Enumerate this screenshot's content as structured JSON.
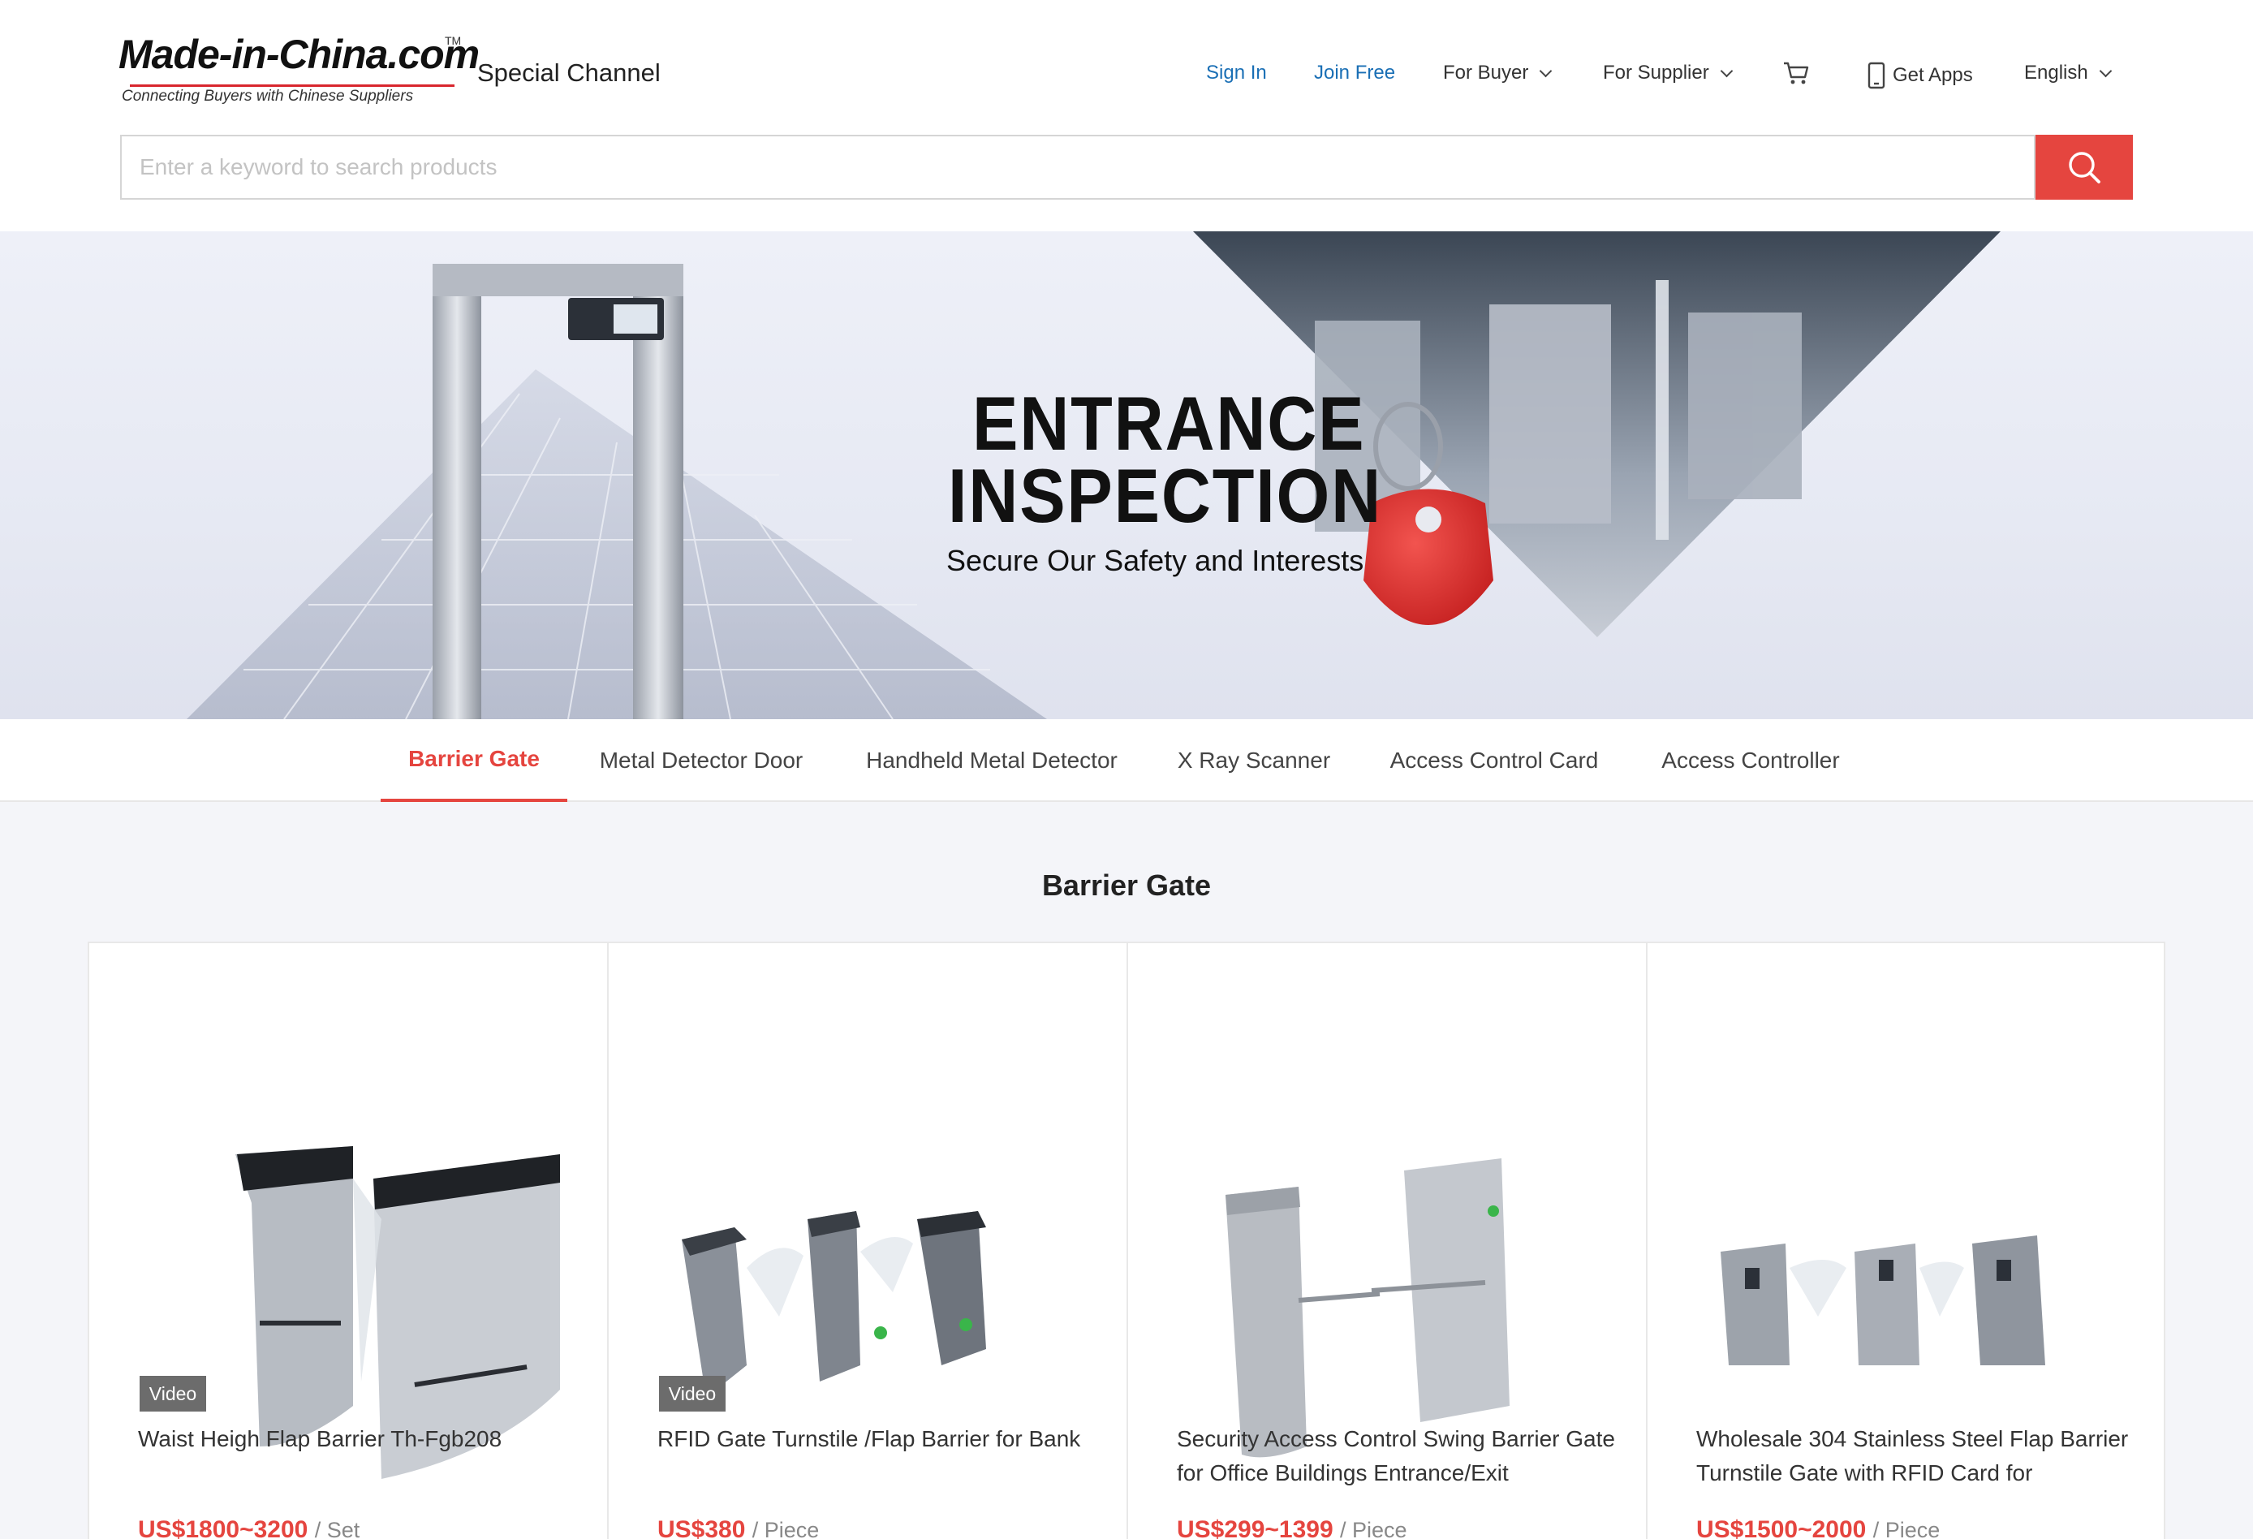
{
  "header": {
    "logo_text": "Made-in-China.com",
    "logo_tm": "TM",
    "logo_tagline": "Connecting Buyers with Chinese Suppliers",
    "channel_label": "Special Channel",
    "nav": {
      "sign_in": "Sign In",
      "join_free": "Join Free",
      "for_buyer": "For Buyer",
      "for_supplier": "For Supplier",
      "get_apps": "Get Apps",
      "language": "English"
    },
    "search": {
      "placeholder": "Enter a keyword to search products",
      "value": ""
    }
  },
  "banner": {
    "title_line1": "ENTRANCE",
    "title_line2": "INSPECTION",
    "subtitle": "Secure Our Safety and Interests"
  },
  "tabs": [
    {
      "label": "Barrier Gate",
      "active": true
    },
    {
      "label": "Metal Detector Door",
      "active": false
    },
    {
      "label": "Handheld Metal Detector",
      "active": false
    },
    {
      "label": "X Ray Scanner",
      "active": false
    },
    {
      "label": "Access Control Card",
      "active": false
    },
    {
      "label": "Access Controller",
      "active": false
    }
  ],
  "section_title": "Barrier Gate",
  "products": [
    {
      "title": "Waist Heigh Flap Barrier Th-Fgb208",
      "price": "US$1800~3200",
      "unit": "/ Set",
      "badge": "Video"
    },
    {
      "title": "RFID Gate Turnstile /Flap Barrier for Bank",
      "price": "US$380",
      "unit": "/ Piece",
      "badge": "Video"
    },
    {
      "title": "Security Access Control Swing Barrier Gate for Office Buildings Entrance/Exit",
      "price": "US$299~1399",
      "unit": "/ Piece",
      "badge": ""
    },
    {
      "title": "Wholesale 304 Stainless Steel Flap Barrier Turnstile Gate with RFID Card for",
      "price": "US$1500~2000",
      "unit": "/ Piece",
      "badge": ""
    }
  ],
  "colors": {
    "accent": "#e5453f",
    "link_blue": "#1a6fb5",
    "logo_red": "#d8262d",
    "page_bg": "#f4f5f9"
  }
}
